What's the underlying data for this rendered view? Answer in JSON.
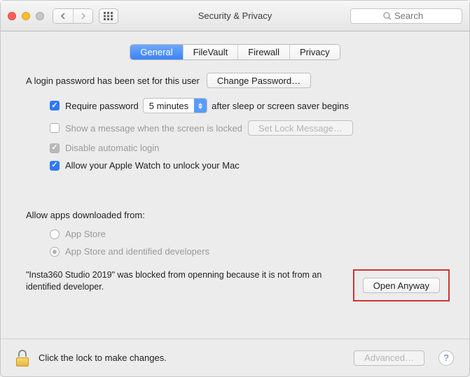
{
  "header": {
    "title": "Security & Privacy",
    "search_placeholder": "Search"
  },
  "tabs": [
    "General",
    "FileVault",
    "Firewall",
    "Privacy"
  ],
  "general": {
    "login_password_text": "A login password has been set for this user",
    "change_password_btn": "Change Password…",
    "require_password_label": "Require password",
    "require_password_delay": "5 minutes",
    "require_password_suffix": "after sleep or screen saver begins",
    "show_message_label": "Show a message when the screen is locked",
    "set_lock_message_btn": "Set Lock Message…",
    "disable_auto_login_label": "Disable automatic login",
    "apple_watch_label": "Allow your Apple Watch to unlock your Mac"
  },
  "downloads": {
    "section_label": "Allow apps downloaded from:",
    "options": [
      "App Store",
      "App Store and identified developers"
    ],
    "blocked_message": "\"Insta360 Studio 2019\" was blocked from openning because it is not from an identified developer.",
    "open_anyway_btn": "Open Anyway"
  },
  "footer": {
    "lock_text": "Click the lock to make changes.",
    "advanced_btn": "Advanced…"
  }
}
